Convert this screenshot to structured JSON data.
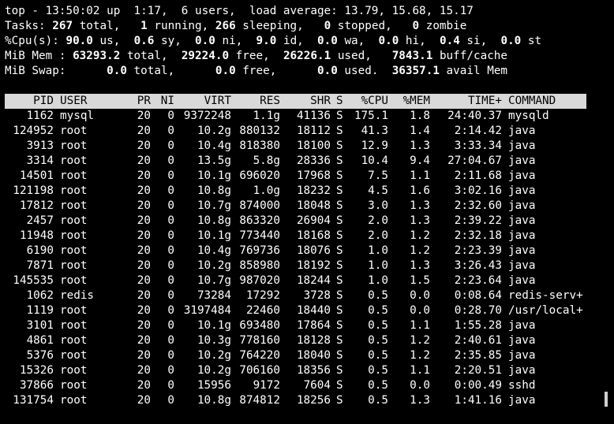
{
  "summary": {
    "line1": "top - 13:50:02 up  1:17,  6 users,  load average: 13.79, 15.68, 15.17",
    "tasks": {
      "label": "Tasks: ",
      "total": "267",
      "t1": " total,   ",
      "running": "1",
      "t2": " running, ",
      "sleeping": "266",
      "t3": " sleeping,   ",
      "stopped": "0",
      "t4": " stopped,   ",
      "zombie": "0",
      "t5": " zombie"
    },
    "cpu": {
      "label": "%Cpu(s): ",
      "us": "90.0",
      "t1": " us,  ",
      "sy": "0.6",
      "t2": " sy,  ",
      "ni": "0.0",
      "t3": " ni,  ",
      "id": "9.0",
      "t4": " id,  ",
      "wa": "0.0",
      "t5": " wa,  ",
      "hi": "0.0",
      "t6": " hi,  ",
      "si": "0.4",
      "t7": " si,  ",
      "st": "0.0",
      "t8": " st"
    },
    "mem": {
      "label": "MiB Mem : ",
      "total": "63293.2",
      "t1": " total,  ",
      "free": "29224.0",
      "t2": " free,  ",
      "used": "26226.1",
      "t3": " used,   ",
      "cache": "7843.1",
      "t4": " buff/cache"
    },
    "swap": {
      "label": "MiB Swap:      ",
      "total": "0.0",
      "t1": " total,      ",
      "free": "0.0",
      "t2": " free,      ",
      "used": "0.0",
      "t3": " used.  ",
      "avail": "36357.1",
      "t4": " avail Mem"
    }
  },
  "columns": [
    "PID",
    "USER",
    "PR",
    "NI",
    "VIRT",
    "RES",
    "SHR",
    "S",
    "%CPU",
    "%MEM",
    "TIME+",
    "COMMAND"
  ],
  "processes": [
    [
      "1162",
      "mysql",
      "20",
      "0",
      "9372248",
      "1.1g",
      "41136",
      "S",
      "175.1",
      "1.8",
      "24:40.37",
      "mysqld"
    ],
    [
      "124952",
      "root",
      "20",
      "0",
      "10.2g",
      "880132",
      "18112",
      "S",
      "41.3",
      "1.4",
      "2:14.42",
      "java"
    ],
    [
      "3913",
      "root",
      "20",
      "0",
      "10.4g",
      "818380",
      "18100",
      "S",
      "12.9",
      "1.3",
      "3:33.34",
      "java"
    ],
    [
      "3314",
      "root",
      "20",
      "0",
      "13.5g",
      "5.8g",
      "28336",
      "S",
      "10.4",
      "9.4",
      "27:04.67",
      "java"
    ],
    [
      "14501",
      "root",
      "20",
      "0",
      "10.1g",
      "696020",
      "17968",
      "S",
      "7.5",
      "1.1",
      "2:11.68",
      "java"
    ],
    [
      "121198",
      "root",
      "20",
      "0",
      "10.8g",
      "1.0g",
      "18232",
      "S",
      "4.5",
      "1.6",
      "3:02.16",
      "java"
    ],
    [
      "17812",
      "root",
      "20",
      "0",
      "10.7g",
      "874000",
      "18048",
      "S",
      "3.0",
      "1.3",
      "2:32.60",
      "java"
    ],
    [
      "2457",
      "root",
      "20",
      "0",
      "10.8g",
      "863320",
      "26904",
      "S",
      "2.0",
      "1.3",
      "2:39.22",
      "java"
    ],
    [
      "11948",
      "root",
      "20",
      "0",
      "10.1g",
      "773440",
      "18168",
      "S",
      "2.0",
      "1.2",
      "2:32.18",
      "java"
    ],
    [
      "6190",
      "root",
      "20",
      "0",
      "10.4g",
      "769736",
      "18076",
      "S",
      "1.0",
      "1.2",
      "2:23.39",
      "java"
    ],
    [
      "7871",
      "root",
      "20",
      "0",
      "10.2g",
      "858980",
      "18192",
      "S",
      "1.0",
      "1.3",
      "3:26.43",
      "java"
    ],
    [
      "145535",
      "root",
      "20",
      "0",
      "10.7g",
      "987020",
      "18244",
      "S",
      "1.0",
      "1.5",
      "2:23.64",
      "java"
    ],
    [
      "1062",
      "redis",
      "20",
      "0",
      "73284",
      "17292",
      "3728",
      "S",
      "0.5",
      "0.0",
      "0:08.64",
      "redis-serv+"
    ],
    [
      "1119",
      "root",
      "20",
      "0",
      "3197484",
      "22460",
      "18440",
      "S",
      "0.5",
      "0.0",
      "0:28.70",
      "/usr/local+"
    ],
    [
      "3101",
      "root",
      "20",
      "0",
      "10.1g",
      "693480",
      "17864",
      "S",
      "0.5",
      "1.1",
      "1:55.28",
      "java"
    ],
    [
      "4861",
      "root",
      "20",
      "0",
      "10.3g",
      "778160",
      "18128",
      "S",
      "0.5",
      "1.2",
      "2:40.61",
      "java"
    ],
    [
      "5376",
      "root",
      "20",
      "0",
      "10.2g",
      "764220",
      "18040",
      "S",
      "0.5",
      "1.2",
      "2:35.85",
      "java"
    ],
    [
      "15326",
      "root",
      "20",
      "0",
      "10.2g",
      "706160",
      "18356",
      "S",
      "0.5",
      "1.1",
      "2:20.51",
      "java"
    ],
    [
      "37866",
      "root",
      "20",
      "0",
      "15956",
      "9172",
      "7604",
      "S",
      "0.5",
      "0.0",
      "0:00.49",
      "sshd"
    ],
    [
      "131754",
      "root",
      "20",
      "0",
      "10.8g",
      "874812",
      "18256",
      "S",
      "0.5",
      "1.3",
      "1:41.16",
      "java"
    ]
  ]
}
